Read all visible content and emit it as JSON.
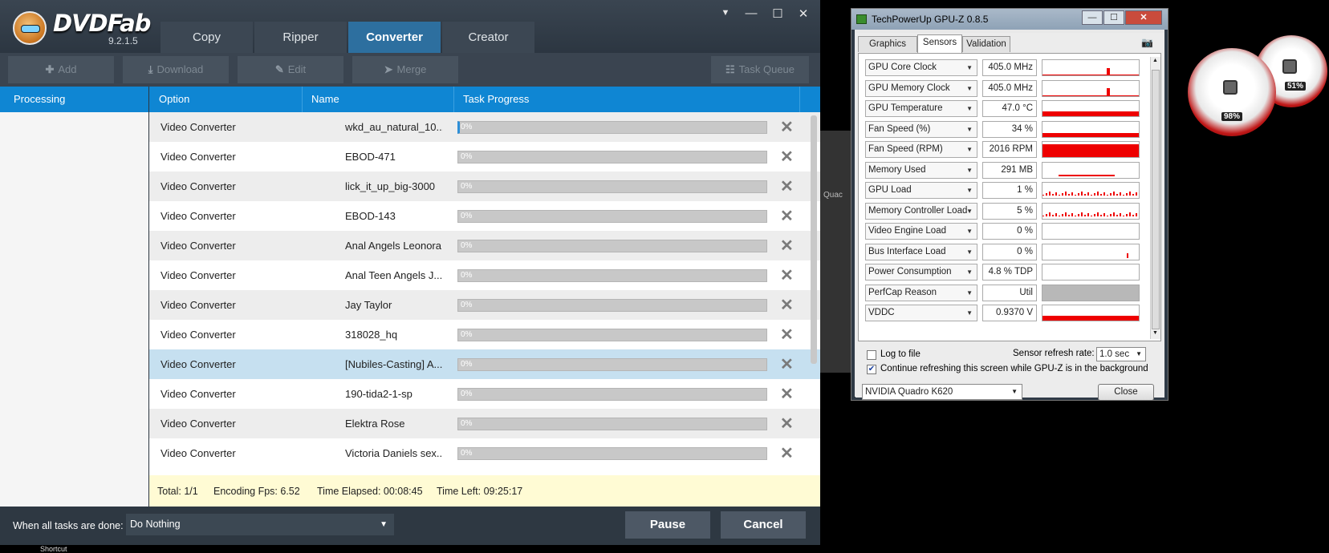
{
  "dvdfab": {
    "brand": "DVDFab",
    "version": "9.2.1.5",
    "tabs": [
      "Copy",
      "Ripper",
      "Converter",
      "Creator"
    ],
    "active_tab": "Converter",
    "window_buttons": {
      "menu": "▼",
      "minimize": "—",
      "maximize": "☐",
      "close": "✕"
    },
    "toolbar": {
      "add": "Add",
      "download": "Download",
      "edit": "Edit",
      "merge": "Merge",
      "task_queue": "Task Queue"
    },
    "sidebar": {
      "header": "Processing"
    },
    "columns": {
      "option": "Option",
      "name": "Name",
      "task_progress": "Task Progress"
    },
    "rows": [
      {
        "option": "Video Converter",
        "name": "wkd_au_natural_10...",
        "progress": "0%"
      },
      {
        "option": "Video Converter",
        "name": "EBOD-471",
        "progress": "0%"
      },
      {
        "option": "Video Converter",
        "name": "lick_it_up_big-3000",
        "progress": "0%"
      },
      {
        "option": "Video Converter",
        "name": "EBOD-143",
        "progress": "0%"
      },
      {
        "option": "Video Converter",
        "name": "Anal Angels Leonora",
        "progress": "0%"
      },
      {
        "option": "Video Converter",
        "name": "Anal Teen Angels J...",
        "progress": "0%"
      },
      {
        "option": "Video Converter",
        "name": "Jay Taylor",
        "progress": "0%"
      },
      {
        "option": "Video Converter",
        "name": "318028_hq",
        "progress": "0%"
      },
      {
        "option": "Video Converter",
        "name": "[Nubiles-Casting] A...",
        "progress": "0%"
      },
      {
        "option": "Video Converter",
        "name": "190-tida2-1-sp",
        "progress": "0%"
      },
      {
        "option": "Video Converter",
        "name": "Elektra Rose",
        "progress": "0%"
      },
      {
        "option": "Video Converter",
        "name": "Victoria Daniels sex...",
        "progress": "0%"
      }
    ],
    "selected_row": 8,
    "status": {
      "total": "Total: 1/1",
      "fps": "Encoding Fps: 6.52",
      "elapsed": "Time Elapsed: 00:08:45",
      "left": "Time Left: 09:25:17"
    },
    "when_done_label": "When all tasks are done:",
    "when_done_value": "Do Nothing",
    "pause": "Pause",
    "cancel": "Cancel"
  },
  "background": {
    "partial_label": "Quac",
    "shortcut_label": "Shortcut"
  },
  "gpuz": {
    "title": "TechPowerUp GPU-Z 0.8.5",
    "tabs": [
      "Graphics Card",
      "Sensors",
      "Validation"
    ],
    "active_tab": "Sensors",
    "sensors": [
      {
        "name": "GPU Core Clock",
        "value": "405.0 MHz"
      },
      {
        "name": "GPU Memory Clock",
        "value": "405.0 MHz"
      },
      {
        "name": "GPU Temperature",
        "value": "47.0 °C"
      },
      {
        "name": "Fan Speed (%)",
        "value": "34 %"
      },
      {
        "name": "Fan Speed (RPM)",
        "value": "2016 RPM"
      },
      {
        "name": "Memory Used",
        "value": "291 MB"
      },
      {
        "name": "GPU Load",
        "value": "1 %"
      },
      {
        "name": "Memory Controller Load",
        "value": "5 %"
      },
      {
        "name": "Video Engine Load",
        "value": "0 %"
      },
      {
        "name": "Bus Interface Load",
        "value": "0 %"
      },
      {
        "name": "Power Consumption",
        "value": "4.8 % TDP"
      },
      {
        "name": "PerfCap Reason",
        "value": "Util"
      },
      {
        "name": "VDDC",
        "value": "0.9370 V"
      }
    ],
    "log_to_file": "Log to file",
    "log_checked": false,
    "refresh_label": "Sensor refresh rate:",
    "refresh_value": "1.0 sec",
    "continue_label": "Continue refreshing this screen while GPU-Z is in the background",
    "continue_checked": true,
    "gpu": "NVIDIA Quadro K620",
    "close": "Close",
    "graph_color": "#ee0000"
  },
  "gadget": {
    "cpu": "98%",
    "memory": "51%",
    "accent": "#c01818"
  }
}
